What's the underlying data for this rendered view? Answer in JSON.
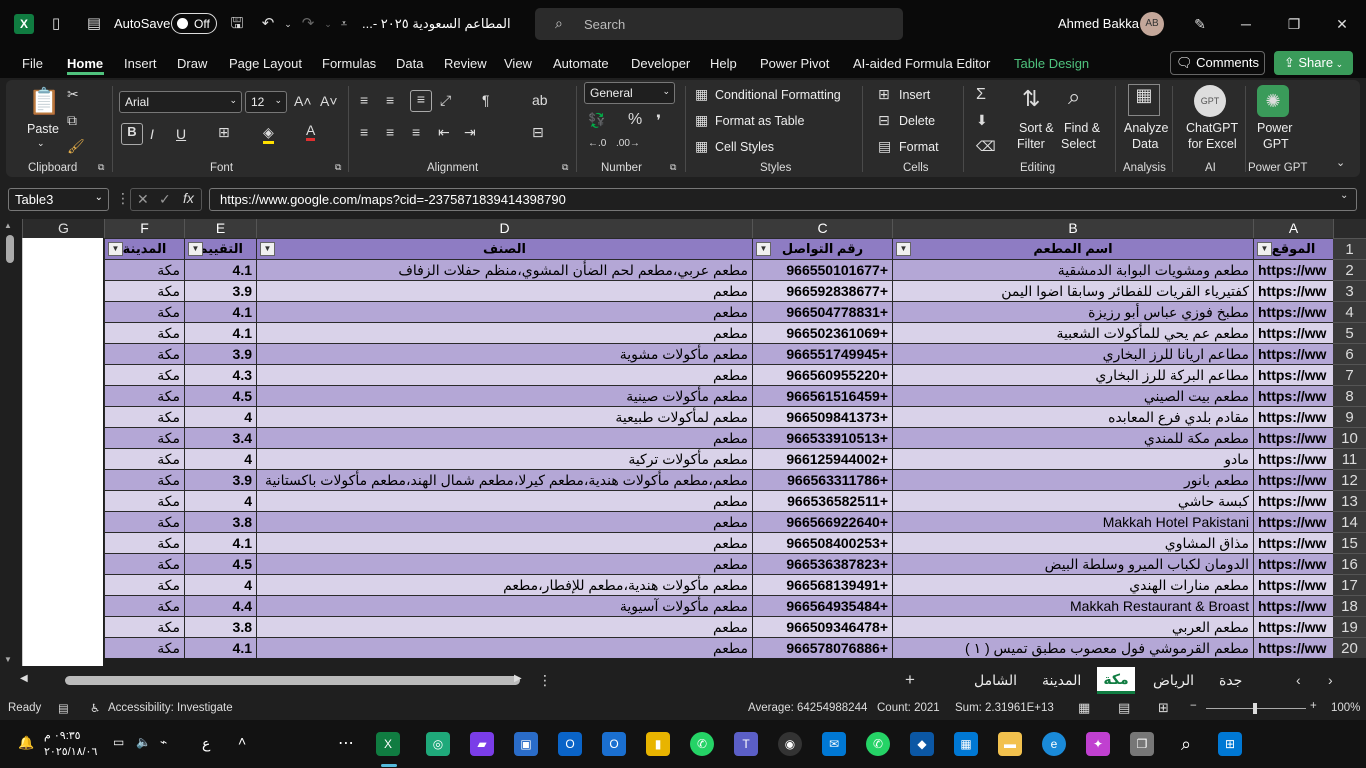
{
  "titlebar": {
    "autosave_label": "AutoSave",
    "autosave_state": "Off",
    "doc_title": "المطاعم السعودية ٢٠٢٥ -...",
    "search_placeholder": "Search",
    "user_name": "Ahmed Bakka",
    "user_initials": "AB"
  },
  "menu": [
    "File",
    "Home",
    "Insert",
    "Draw",
    "Page Layout",
    "Formulas",
    "Data",
    "Review",
    "View",
    "Automate",
    "Developer",
    "Help",
    "Power Pivot",
    "AI-aided Formula Editor",
    "Table Design"
  ],
  "menu_active": "Home",
  "comments_label": "Comments",
  "share_label": "Share",
  "ribbon": {
    "clipboard": {
      "paste": "Paste",
      "group": "Clipboard"
    },
    "font": {
      "name": "Arial",
      "size": "12",
      "group": "Font"
    },
    "alignment": {
      "group": "Alignment"
    },
    "number": {
      "format": "General",
      "group": "Number"
    },
    "styles": {
      "conditional": "Conditional Formatting",
      "format_table": "Format as Table",
      "cell_styles": "Cell Styles",
      "group": "Styles"
    },
    "cells": {
      "insert": "Insert",
      "delete": "Delete",
      "format": "Format",
      "group": "Cells"
    },
    "editing": {
      "sort1": "Sort &",
      "sort2": "Filter",
      "find1": "Find &",
      "find2": "Select",
      "group": "Editing"
    },
    "analysis": {
      "l1": "Analyze",
      "l2": "Data",
      "group": "Analysis"
    },
    "ai": {
      "l1": "ChatGPT",
      "l2": "for Excel",
      "group": "AI"
    },
    "powergpt": {
      "l1": "Power",
      "l2": "GPT",
      "group": "Power GPT"
    }
  },
  "namebox": "Table3",
  "formula": "https://www.google.com/maps?cid=-2375871839414398790",
  "columns": [
    "G",
    "F",
    "E",
    "D",
    "C",
    "B",
    "A"
  ],
  "headers": {
    "A": "الموقع",
    "B": "اسم المطعم",
    "C": "رقم التواصل",
    "D": "الصنف",
    "E": "التقييم",
    "F": "المدينة"
  },
  "rows": [
    {
      "n": "2",
      "a": "https://ww",
      "b": "مطعم ومشويات البوابة الدمشقية",
      "c": "+966550101677",
      "d": "مطعم عربي،مطعم لحم الضأن المشوي،منظم حفلات الزفاف",
      "e": "4.1",
      "f": "مكة"
    },
    {
      "n": "3",
      "a": "https://ww",
      "b": "كفتيرياء القريات للفطائر وسابقا اضوا اليمن",
      "c": "+966592838677",
      "d": "مطعم",
      "e": "3.9",
      "f": "مكة"
    },
    {
      "n": "4",
      "a": "https://ww",
      "b": "مطبخ فوزي عباس أبو رزيزة",
      "c": "+966504778831",
      "d": "مطعم",
      "e": "4.1",
      "f": "مكة"
    },
    {
      "n": "5",
      "a": "https://ww",
      "b": "مطعم عم يحي للمأكولات الشعبية",
      "c": "+966502361069",
      "d": "مطعم",
      "e": "4.1",
      "f": "مكة"
    },
    {
      "n": "6",
      "a": "https://ww",
      "b": "مطاعم اريانا للرز البخاري",
      "c": "+966551749945",
      "d": "مطعم مأكولات مشوية",
      "e": "3.9",
      "f": "مكة"
    },
    {
      "n": "7",
      "a": "https://ww",
      "b": "مطاعم البركة للرز البخاري",
      "c": "+966560955220",
      "d": "مطعم",
      "e": "4.3",
      "f": "مكة"
    },
    {
      "n": "8",
      "a": "https://ww",
      "b": "مطعم بيت الصيني",
      "c": "+966561516459",
      "d": "مطعم مأكولات صينية",
      "e": "4.5",
      "f": "مكة"
    },
    {
      "n": "9",
      "a": "https://ww",
      "b": "مقادم بلدي فرع المعابده",
      "c": "+966509841373",
      "d": "مطعم لمأكولات طبيعية",
      "e": "4",
      "f": "مكة"
    },
    {
      "n": "10",
      "a": "https://ww",
      "b": "مطعم مكة للمندي",
      "c": "+966533910513",
      "d": "مطعم",
      "e": "3.4",
      "f": "مكة"
    },
    {
      "n": "11",
      "a": "https://ww",
      "b": "مادو",
      "c": "+966125944002",
      "d": "مطعم مأكولات تركية",
      "e": "4",
      "f": "مكة"
    },
    {
      "n": "12",
      "a": "https://ww",
      "b": "مطعم بانور",
      "c": "+966563311786",
      "d": "مطعم،مطعم مأكولات هندية،مطعم كيرلا،مطعم شمال الهند،مطعم مأكولات باكستانية",
      "e": "3.9",
      "f": "مكة"
    },
    {
      "n": "13",
      "a": "https://ww",
      "b": "كبسة حاشي",
      "c": "+966536582511",
      "d": "مطعم",
      "e": "4",
      "f": "مكة"
    },
    {
      "n": "14",
      "a": "https://ww",
      "b": "Makkah Hotel Pakistani",
      "c": "+966566922640",
      "d": "مطعم",
      "e": "3.8",
      "f": "مكة"
    },
    {
      "n": "15",
      "a": "https://ww",
      "b": "مذاق المشاوي",
      "c": "+966508400253",
      "d": "مطعم",
      "e": "4.1",
      "f": "مكة"
    },
    {
      "n": "16",
      "a": "https://ww",
      "b": "الدومان لكباب الميرو وسلطة البيض",
      "c": "+966536387823",
      "d": "مطعم",
      "e": "4.5",
      "f": "مكة"
    },
    {
      "n": "17",
      "a": "https://ww",
      "b": "مطعم منارات الهندي",
      "c": "+966568139491",
      "d": "مطعم مأكولات هندية،مطعم للإفطار،مطعم",
      "e": "4",
      "f": "مكة"
    },
    {
      "n": "18",
      "a": "https://ww",
      "b": "Makkah Restaurant & Broast",
      "c": "+966564935484",
      "d": "مطعم مأكولات آسيوية",
      "e": "4.4",
      "f": "مكة"
    },
    {
      "n": "19",
      "a": "https://ww",
      "b": "مطعم العربي",
      "c": "+966509346478",
      "d": "مطعم",
      "e": "3.8",
      "f": "مكة"
    },
    {
      "n": "20",
      "a": "https://ww",
      "b": "مطعم القرموشي فول معصوب مطبق تميس ( ١ )",
      "c": "+966578076886",
      "d": "مطعم",
      "e": "4.1",
      "f": "مكة"
    }
  ],
  "sheet_tabs": [
    "جدة",
    "الرياض",
    "مكة",
    "المدينة",
    "الشامل"
  ],
  "active_sheet": "مكة",
  "status": {
    "ready": "Ready",
    "accessibility": "Accessibility: Investigate",
    "average": "Average: 64254988244",
    "count": "Count: 2021",
    "sum": "Sum: 2.31961E+13",
    "zoom": "100%"
  },
  "taskbar": {
    "time": "٠٩:٣٥ م",
    "date": "٢٠٢٥/١٨/٠٦",
    "lang": "ع"
  }
}
